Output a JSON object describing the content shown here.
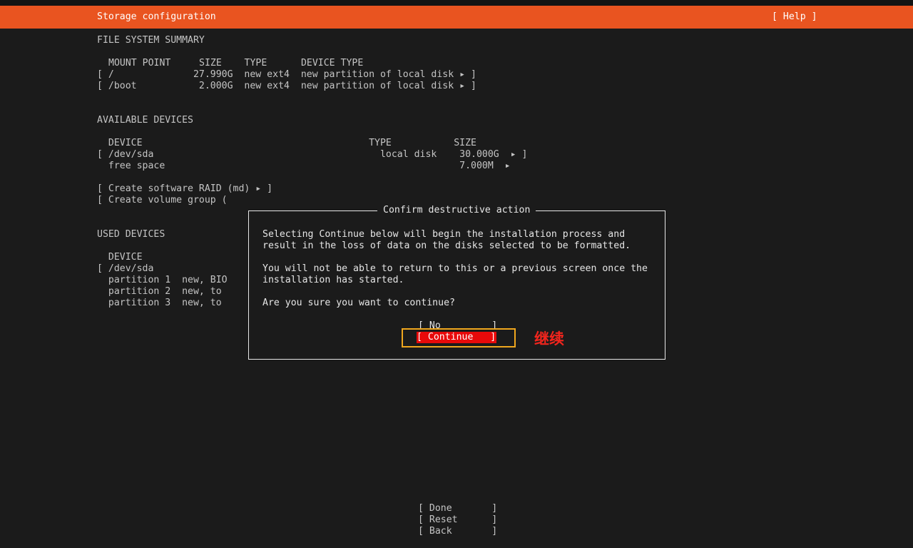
{
  "header": {
    "title": "Storage configuration",
    "help_label": "[ Help ]"
  },
  "fs_summary": {
    "heading": "FILE SYSTEM SUMMARY",
    "columns": "MOUNT POINT     SIZE    TYPE      DEVICE TYPE",
    "rows": [
      "[ /              27.990G  new ext4  new partition of local disk ▸ ]",
      "[ /boot           2.000G  new ext4  new partition of local disk ▸ ]"
    ]
  },
  "available": {
    "heading": "AVAILABLE DEVICES",
    "columns": "  DEVICE                                        TYPE           SIZE",
    "rows": [
      "[ /dev/sda                                        local disk    30.000G  ▸ ]",
      "  free space                                                    7.000M  ▸"
    ],
    "actions": [
      "[ Create software RAID (md) ▸ ]",
      "[ Create volume group ("
    ]
  },
  "used": {
    "heading": "USED DEVICES",
    "columns": "  DEVICE",
    "rows": [
      "[ /dev/sda",
      "  partition 1  new, BIO",
      "  partition 2  new, to",
      "  partition 3  new, to"
    ]
  },
  "dialog": {
    "title": "Confirm destructive action",
    "lines": [
      "Selecting Continue below will begin the installation process and",
      "result in the loss of data on the disks selected to be formatted.",
      "You will not be able to return to this or a previous screen once the",
      "installation has started.",
      "Are you sure you want to continue?"
    ],
    "no_label": "[ No         ]",
    "continue_label": "[ Continue   ]"
  },
  "annotation": {
    "text": "继续",
    "color": "#f2251d",
    "box_color": "#f0a71e"
  },
  "footer": {
    "done_label": "[ Done       ]",
    "reset_label": "[ Reset      ]",
    "back_label": "[ Back       ]"
  },
  "colors": {
    "accent": "#e95420",
    "background": "#1b1b1b",
    "button_focus": "#e8090a"
  }
}
